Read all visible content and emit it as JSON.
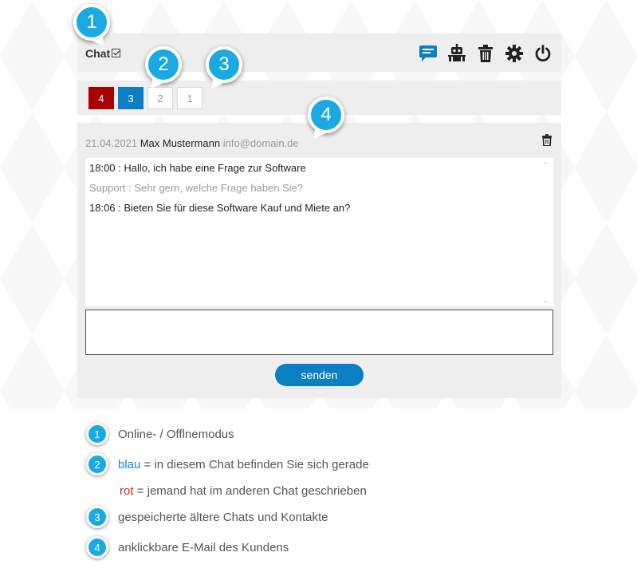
{
  "header": {
    "chat_label": "Chat",
    "icons": [
      "chat-bubble-icon",
      "robot-icon",
      "trash-icon",
      "gear-icon",
      "power-icon"
    ]
  },
  "tabs": [
    {
      "label": "4",
      "state": "red"
    },
    {
      "label": "3",
      "state": "blue"
    },
    {
      "label": "2",
      "state": "plain"
    },
    {
      "label": "1",
      "state": "plain"
    }
  ],
  "chat": {
    "date": "21.04.2021",
    "name": "Max Mustermann",
    "email": "info@domain.de",
    "messages": [
      {
        "text": "18:00 : Hallo, ich habe eine Frage zur Software",
        "from": "customer"
      },
      {
        "text": "Support : Sehr gern, welche Frage haben Sie?",
        "from": "support"
      },
      {
        "text": "18:06 : Bieten Sie für diese Software Kauf und Miete an?",
        "from": "customer"
      }
    ],
    "input_value": "",
    "send_label": "senden",
    "scroll_up": "⌃",
    "scroll_down": "⌄"
  },
  "callouts": [
    "1",
    "2",
    "3",
    "4"
  ],
  "legend": {
    "item1": {
      "num": "1",
      "text": "Online- / Offlnemodus"
    },
    "item2": {
      "num": "2",
      "blue_word": "blau",
      "text": " = in diesem Chat befinden Sie sich gerade"
    },
    "item2b": {
      "red_word": "rot",
      "text": " = jemand hat im anderen Chat geschrieben"
    },
    "item3": {
      "num": "3",
      "text": "gespeicherte ältere Chats und Kontakte"
    },
    "item4": {
      "num": "4",
      "text": "anklickbare E-Mail des Kundens"
    }
  },
  "colors": {
    "accent_blue": "#0a7fc2",
    "bubble_blue": "#1aa9e0",
    "alert_red": "#a90000",
    "panel_bg": "#eeeeee"
  }
}
